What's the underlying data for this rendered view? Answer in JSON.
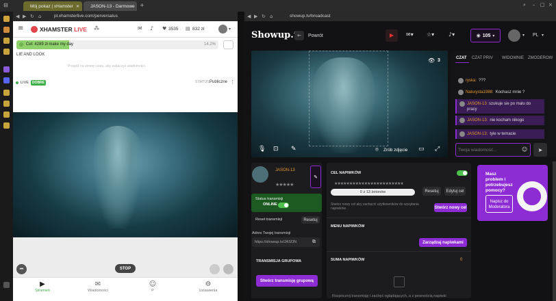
{
  "browser": {
    "tab_left_title": "Mój pokaz | xHamster",
    "tab_right_title": "JASON-13 - Darmowe",
    "url_left": "pl.xhamsterlive.com/perversalus",
    "url_right": "showup.tv/broadcast"
  },
  "xh": {
    "logo_main": "XHAMSTER",
    "logo_live": "LIVE",
    "coins": "3535",
    "tokens": "832 zł",
    "goal_text": "Cel: 4289 zł make my day",
    "goal_percent_label": "14.2%",
    "goal_progress": 0.142,
    "subject": "LIE AND LOOK",
    "chat_placeholder": "Przejdź na stronę czatu, aby zobaczyć wiadomości",
    "live_label": "LIVE",
    "quality_badge": "DOBRE",
    "status_label": "STATUS:",
    "status_value": "Publiczne",
    "stop_label": "STOP",
    "nav": {
      "stream": "Strumień",
      "messages": "Wiadomości",
      "profile": "P",
      "settings": "Ustawienia"
    }
  },
  "su": {
    "logo": "Showup.tv",
    "back_label": "Powrót",
    "tokens": "105",
    "lang": "PL",
    "viewers": "3",
    "snapshot_label": "Zrób zdjęcie",
    "chat_tabs": [
      "CZAT",
      "CZAT PRIV",
      "WIDOWNIE",
      "ZMODEROW"
    ],
    "chat_messages": [
      {
        "user": "ryska:",
        "text": "???",
        "highlight": false
      },
      {
        "user": "Naturysta1988:",
        "text": "Kochasz mnie ?",
        "highlight": false
      },
      {
        "user": "JASON-13:",
        "text": "szukuje sie po malu do pracy",
        "highlight": true
      },
      {
        "user": "JASON-13:",
        "text": "nie kocham nikogo",
        "highlight": true
      },
      {
        "user": "JASON-13:",
        "text": "tyle w temacie",
        "highlight": true
      }
    ],
    "chat_input_placeholder": "Twoja wiadomość...",
    "username": "JASON-13",
    "stars": "★★★★★",
    "status_transmisji_label": "Status transmisji",
    "online_label": "ONLINE",
    "reset_transmisji_label": "Reset transmisji",
    "reset_btn": "Resetuj",
    "address_label": "Adres Twojej transmisji",
    "address_value": "https://showup.tv/JASON",
    "group_label": "TRANSMISJA GRUPOWA",
    "group_btn": "Stwórz transmisję grupową",
    "goal_title": "CEL NAPIWKÓW",
    "goal_stars": "★★★★★★★★★★★★★★★★★★★★★★★",
    "goal_progress_text": "0 z 13 żetonów",
    "goal_progress": 0.0,
    "goal_reset_btn": "Resetuj",
    "goal_edit_btn": "Edytuj cel",
    "goal_note": "Stwórz nowy cel aby zachęcić użytkowników do wysyłania napiwków.",
    "goal_new_btn": "Stwórz nowy cel",
    "menu_title": "MENU NAPIWKÓW",
    "menu_btn": "Zarządzaj napiwkami",
    "sum_title": "SUMA NAPIWKÓW",
    "sum_value": "0",
    "sum_note": "Rozpocznij transmisję i zachęć oglądających, a z pewnością napiwki",
    "promo_text": "Masz problem i potrzebujesz pomocy?",
    "promo_btn": "Napisz do Moderatora"
  }
}
